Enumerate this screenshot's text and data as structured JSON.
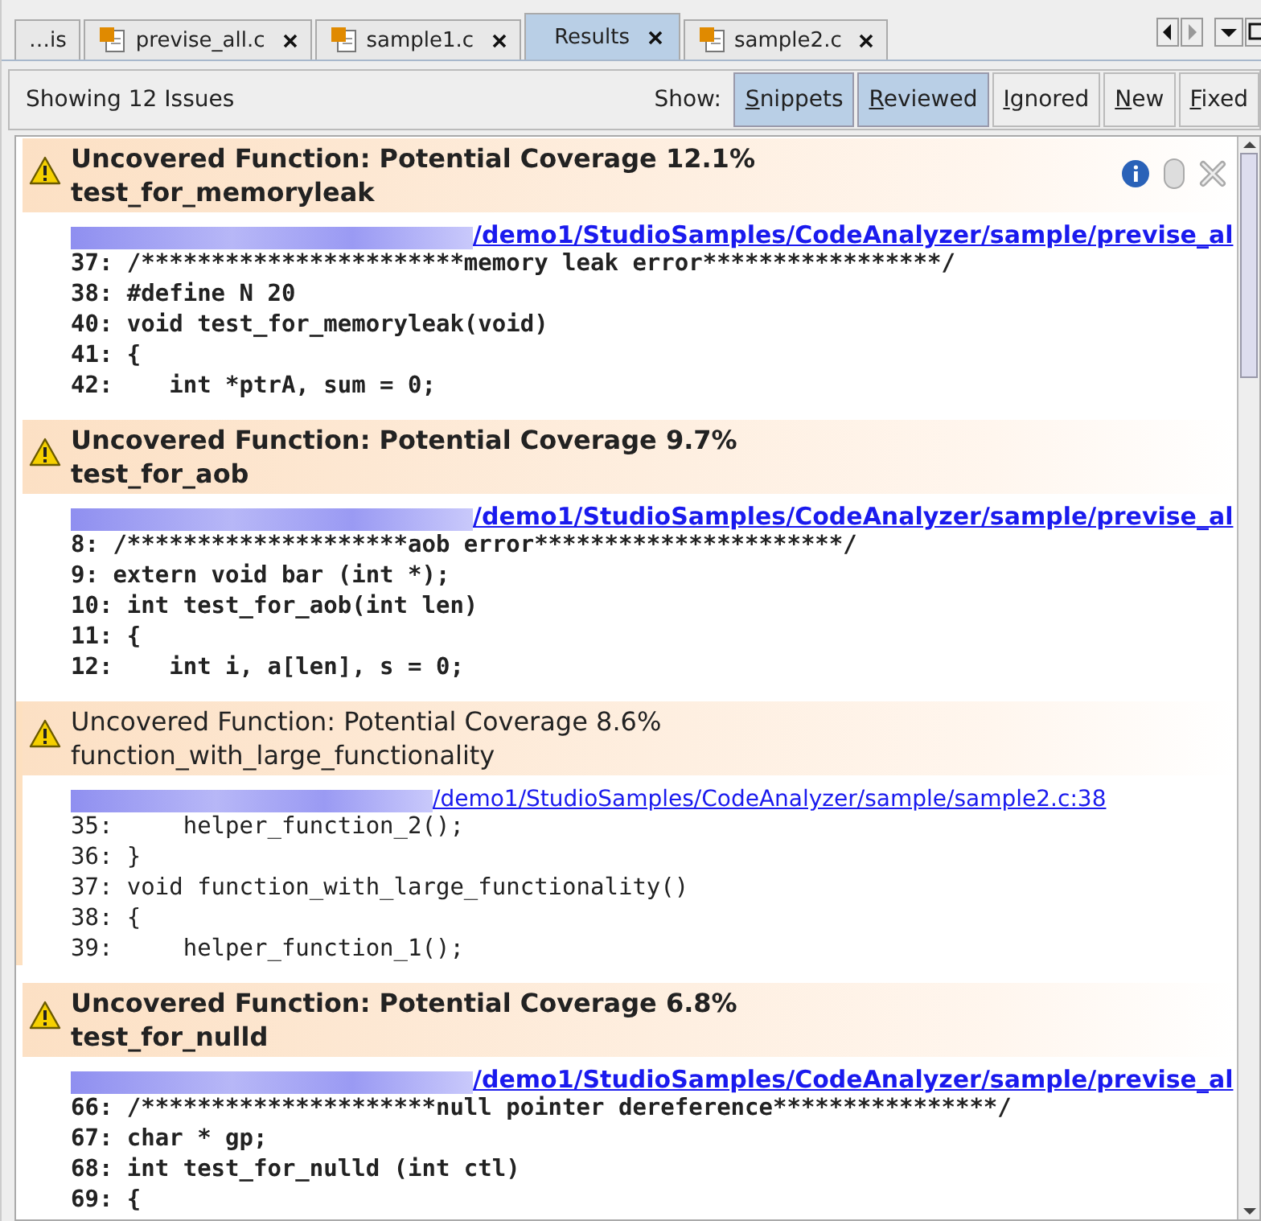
{
  "tabs": [
    {
      "label": "…is",
      "file_icon": false,
      "selected": false
    },
    {
      "label": "previse_all.c",
      "file_icon": true,
      "selected": false
    },
    {
      "label": "sample1.c",
      "file_icon": true,
      "selected": false
    },
    {
      "label": "Results",
      "file_icon": false,
      "selected": true
    },
    {
      "label": "sample2.c",
      "file_icon": true,
      "selected": false
    }
  ],
  "toolbar": {
    "status": "Showing 12 Issues",
    "show_label": "Show:",
    "filters": [
      {
        "label": "Snippets",
        "selected": true
      },
      {
        "label": "Reviewed",
        "selected": true
      },
      {
        "label": "Ignored",
        "selected": false
      },
      {
        "label": "New",
        "selected": false
      },
      {
        "label": "Fixed",
        "selected": false
      }
    ]
  },
  "issues": [
    {
      "title": "Uncovered Function: Potential Coverage 12.1%",
      "function": "test_for_memoryleak",
      "reviewed": false,
      "actions_visible": true,
      "link": "/demo1/StudioSamples/CodeAnalyzer/sample/previse_al",
      "lines": [
        "37: /***********************memory leak error*****************/",
        "38: #define N 20",
        "40: void test_for_memoryleak(void)",
        "41: {",
        "42:    int *ptrA, sum = 0;"
      ]
    },
    {
      "title": "Uncovered Function: Potential Coverage 9.7%",
      "function": "test_for_aob",
      "reviewed": false,
      "actions_visible": false,
      "link": "/demo1/StudioSamples/CodeAnalyzer/sample/previse_al",
      "lines": [
        "8: /********************aob error**********************/",
        "9: extern void bar (int *);",
        "10: int test_for_aob(int len)",
        "11: {",
        "12:    int i, a[len], s = 0;"
      ]
    },
    {
      "title": "Uncovered Function: Potential Coverage 8.6%",
      "function": "function_with_large_functionality",
      "reviewed": true,
      "actions_visible": false,
      "link": "/demo1/StudioSamples/CodeAnalyzer/sample/sample2.c:38",
      "lines": [
        "35:     helper_function_2();",
        "36: }",
        "37: void function_with_large_functionality()",
        "38: {",
        "39:     helper_function_1();"
      ]
    },
    {
      "title": "Uncovered Function: Potential Coverage 6.8%",
      "function": "test_for_nulld",
      "reviewed": false,
      "actions_visible": false,
      "link": "/demo1/StudioSamples/CodeAnalyzer/sample/previse_al",
      "lines": [
        "66: /*********************null pointer dereference****************/",
        "67: char * gp;",
        "68: int test_for_nulld (int ctl)",
        "69: {"
      ]
    }
  ]
}
